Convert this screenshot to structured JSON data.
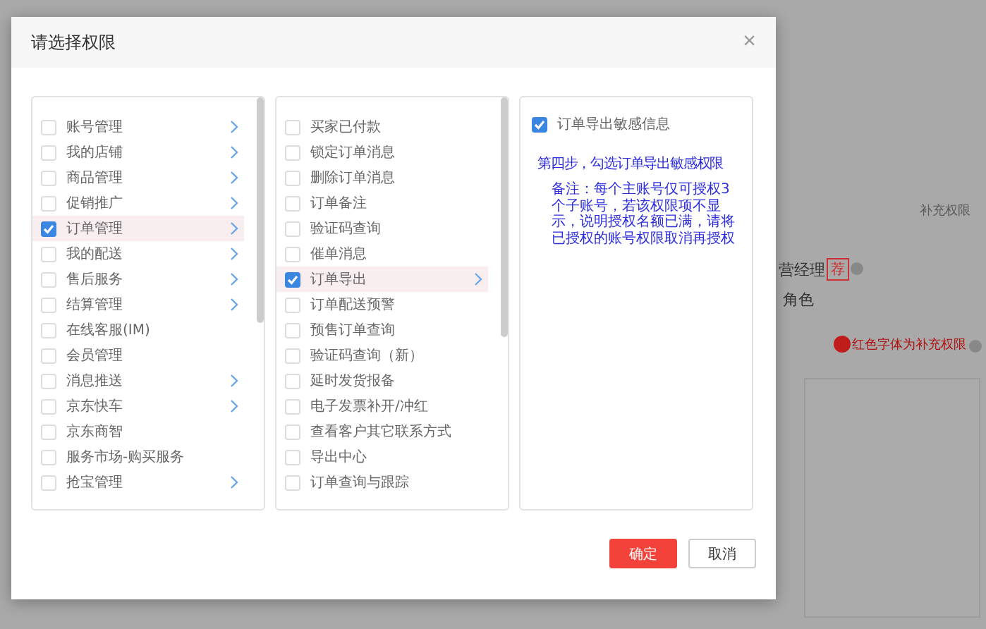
{
  "background": {
    "supplement_link": "补充权限",
    "role_name": "营经理",
    "role_badge": "荐",
    "role_other": "角色",
    "legend": "红色字体为补充权限"
  },
  "dialog": {
    "title": "请选择权限",
    "close": "×",
    "columns": [
      {
        "items": [
          {
            "label": "账号管理",
            "checked": false,
            "selected": false,
            "has_children": true
          },
          {
            "label": "我的店铺",
            "checked": false,
            "selected": false,
            "has_children": true
          },
          {
            "label": "商品管理",
            "checked": false,
            "selected": false,
            "has_children": true
          },
          {
            "label": "促销推广",
            "checked": false,
            "selected": false,
            "has_children": true
          },
          {
            "label": "订单管理",
            "checked": true,
            "selected": true,
            "has_children": true
          },
          {
            "label": "我的配送",
            "checked": false,
            "selected": false,
            "has_children": true
          },
          {
            "label": "售后服务",
            "checked": false,
            "selected": false,
            "has_children": true
          },
          {
            "label": "结算管理",
            "checked": false,
            "selected": false,
            "has_children": true
          },
          {
            "label": "在线客服(IM)",
            "checked": false,
            "selected": false,
            "has_children": false
          },
          {
            "label": "会员管理",
            "checked": false,
            "selected": false,
            "has_children": false
          },
          {
            "label": "消息推送",
            "checked": false,
            "selected": false,
            "has_children": true
          },
          {
            "label": "京东快车",
            "checked": false,
            "selected": false,
            "has_children": true
          },
          {
            "label": "京东商智",
            "checked": false,
            "selected": false,
            "has_children": false
          },
          {
            "label": "服务市场-购买服务",
            "checked": false,
            "selected": false,
            "has_children": false
          },
          {
            "label": "抢宝管理",
            "checked": false,
            "selected": false,
            "has_children": true
          }
        ]
      },
      {
        "items": [
          {
            "label": "买家已付款",
            "checked": false,
            "selected": false,
            "has_children": false
          },
          {
            "label": "锁定订单消息",
            "checked": false,
            "selected": false,
            "has_children": false
          },
          {
            "label": "删除订单消息",
            "checked": false,
            "selected": false,
            "has_children": false
          },
          {
            "label": "订单备注",
            "checked": false,
            "selected": false,
            "has_children": false
          },
          {
            "label": "验证码查询",
            "checked": false,
            "selected": false,
            "has_children": false
          },
          {
            "label": "催单消息",
            "checked": false,
            "selected": false,
            "has_children": false
          },
          {
            "label": "订单导出",
            "checked": true,
            "selected": true,
            "has_children": true
          },
          {
            "label": "订单配送预警",
            "checked": false,
            "selected": false,
            "has_children": false
          },
          {
            "label": "预售订单查询",
            "checked": false,
            "selected": false,
            "has_children": false
          },
          {
            "label": "验证码查询（新）",
            "checked": false,
            "selected": false,
            "has_children": false
          },
          {
            "label": "延时发货报备",
            "checked": false,
            "selected": false,
            "has_children": false
          },
          {
            "label": "电子发票补开/冲红",
            "checked": false,
            "selected": false,
            "has_children": false
          },
          {
            "label": "查看客户其它联系方式",
            "checked": false,
            "selected": false,
            "has_children": false
          },
          {
            "label": "导出中心",
            "checked": false,
            "selected": false,
            "has_children": false
          },
          {
            "label": "订单查询与跟踪",
            "checked": false,
            "selected": false,
            "has_children": false
          }
        ]
      }
    ],
    "detail": {
      "label": "订单导出敏感信息",
      "checked": true,
      "step": "第四步，勾选订单导出敏感权限",
      "note": "备注：每个主账号仅可授权3个子账号，若该权限项不显示，说明授权名额已满，请将已授权的账号权限取消再授权"
    },
    "buttons": [
      {
        "label": "确定",
        "kind": "primary"
      },
      {
        "label": "取消",
        "kind": "secondary"
      }
    ]
  }
}
